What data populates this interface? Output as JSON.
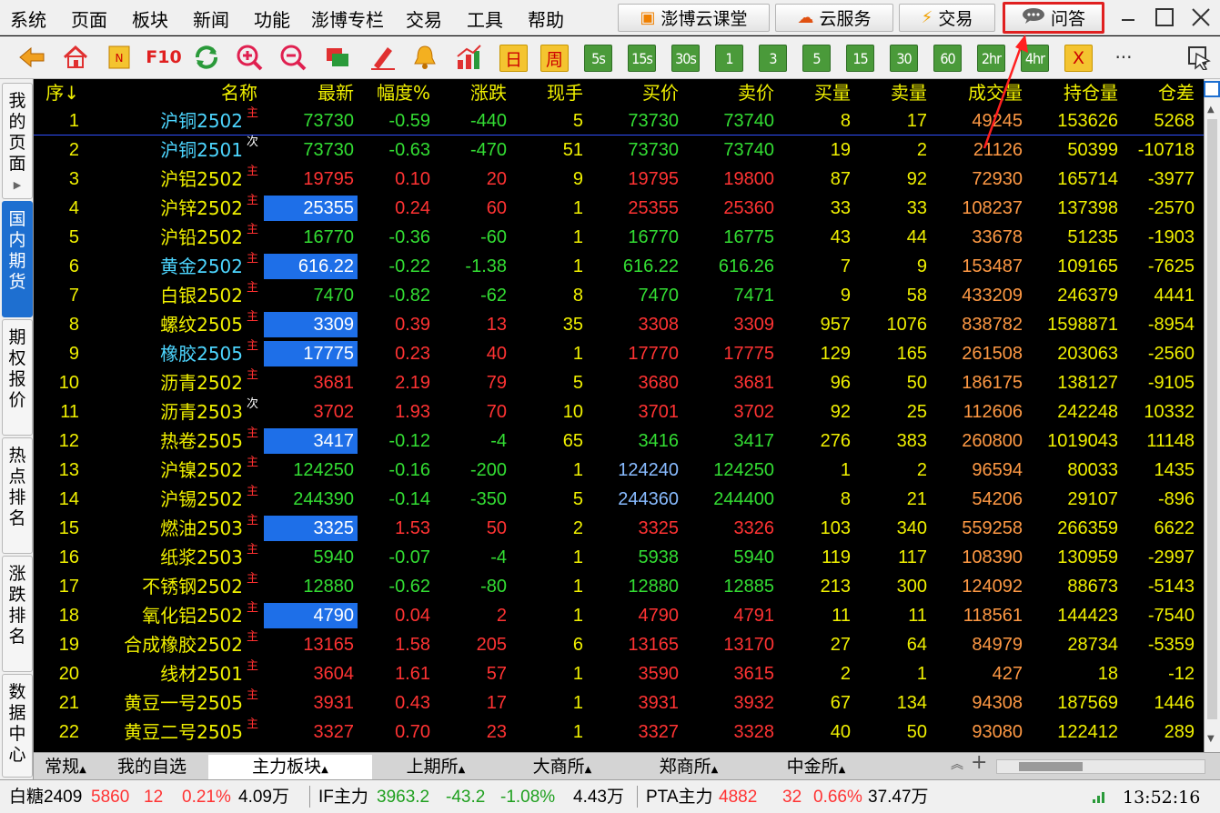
{
  "menu": [
    "系统",
    "页面",
    "板块",
    "新闻",
    "功能",
    "澎博专栏",
    "交易",
    "工具",
    "帮助"
  ],
  "top_buttons": [
    {
      "label": "澎博云课堂",
      "icon": "classroom-icon"
    },
    {
      "label": "云服务",
      "icon": "cloud-icon"
    },
    {
      "label": "交易",
      "icon": "lightning-icon"
    },
    {
      "label": "问答",
      "icon": "chat-bubble-icon"
    }
  ],
  "toolbar": {
    "f10_label": "F10",
    "day_label": "日",
    "week_label": "周",
    "periods": [
      "5s",
      "15s",
      "30s",
      "1",
      "3",
      "5",
      "15",
      "30",
      "60",
      "2hr",
      "4hr"
    ],
    "x_label": "X",
    "more_label": "···"
  },
  "sidebar": [
    {
      "label": [
        "我",
        "的",
        "页",
        "面"
      ],
      "arrow": "▶"
    },
    {
      "label": [
        "国",
        "内",
        "期",
        "货"
      ]
    },
    {
      "label": [
        "期",
        "权",
        "报",
        "价"
      ]
    },
    {
      "label": [
        "热",
        "点",
        "排",
        "名"
      ]
    },
    {
      "label": [
        "涨",
        "跌",
        "排",
        "名"
      ]
    },
    {
      "label": [
        "数",
        "据",
        "中",
        "心"
      ]
    }
  ],
  "columns": [
    "序↓",
    "名称",
    "最新",
    "幅度%",
    "涨跌",
    "现手",
    "买价",
    "卖价",
    "买量",
    "卖量",
    "成交量",
    "持仓量",
    "仓差"
  ],
  "rows": [
    [
      "1",
      "沪铜2502",
      "主",
      "73730",
      "-0.59",
      "-440",
      "5",
      "73730",
      "73740",
      "8",
      "17",
      "49245",
      "153626",
      "5268"
    ],
    [
      "2",
      "沪铜2501",
      "次",
      "73730",
      "-0.63",
      "-470",
      "51",
      "73730",
      "73740",
      "19",
      "2",
      "21126",
      "50399",
      "-10718"
    ],
    [
      "3",
      "沪铝2502",
      "主",
      "19795",
      "0.10",
      "20",
      "9",
      "19795",
      "19800",
      "87",
      "92",
      "72930",
      "165714",
      "-3977"
    ],
    [
      "4",
      "沪锌2502",
      "主",
      "25355",
      "0.24",
      "60",
      "1",
      "25355",
      "25360",
      "33",
      "33",
      "108237",
      "137398",
      "-2570"
    ],
    [
      "5",
      "沪铅2502",
      "主",
      "16770",
      "-0.36",
      "-60",
      "1",
      "16770",
      "16775",
      "43",
      "44",
      "33678",
      "51235",
      "-1903"
    ],
    [
      "6",
      "黄金2502",
      "主",
      "616.22",
      "-0.22",
      "-1.38",
      "1",
      "616.22",
      "616.26",
      "7",
      "9",
      "153487",
      "109165",
      "-7625"
    ],
    [
      "7",
      "白银2502",
      "主",
      "7470",
      "-0.82",
      "-62",
      "8",
      "7470",
      "7471",
      "9",
      "58",
      "433209",
      "246379",
      "4441"
    ],
    [
      "8",
      "螺纹2505",
      "主",
      "3309",
      "0.39",
      "13",
      "35",
      "3308",
      "3309",
      "957",
      "1076",
      "838782",
      "1598871",
      "-8954"
    ],
    [
      "9",
      "橡胶2505",
      "主",
      "17775",
      "0.23",
      "40",
      "1",
      "17770",
      "17775",
      "129",
      "165",
      "261508",
      "203063",
      "-2560"
    ],
    [
      "10",
      "沥青2502",
      "主",
      "3681",
      "2.19",
      "79",
      "5",
      "3680",
      "3681",
      "96",
      "50",
      "186175",
      "138127",
      "-9105"
    ],
    [
      "11",
      "沥青2503",
      "次",
      "3702",
      "1.93",
      "70",
      "10",
      "3701",
      "3702",
      "92",
      "25",
      "112606",
      "242248",
      "10332"
    ],
    [
      "12",
      "热卷2505",
      "主",
      "3417",
      "-0.12",
      "-4",
      "65",
      "3416",
      "3417",
      "276",
      "383",
      "260800",
      "1019043",
      "11148"
    ],
    [
      "13",
      "沪镍2502",
      "主",
      "124250",
      "-0.16",
      "-200",
      "1",
      "124240",
      "124250",
      "1",
      "2",
      "96594",
      "80033",
      "1435"
    ],
    [
      "14",
      "沪锡2502",
      "主",
      "244390",
      "-0.14",
      "-350",
      "5",
      "244360",
      "244400",
      "8",
      "21",
      "54206",
      "29107",
      "-896"
    ],
    [
      "15",
      "燃油2503",
      "主",
      "3325",
      "1.53",
      "50",
      "2",
      "3325",
      "3326",
      "103",
      "340",
      "559258",
      "266359",
      "6622"
    ],
    [
      "16",
      "纸浆2503",
      "主",
      "5940",
      "-0.07",
      "-4",
      "1",
      "5938",
      "5940",
      "119",
      "117",
      "108390",
      "130959",
      "-2997"
    ],
    [
      "17",
      "不锈钢2502",
      "主",
      "12880",
      "-0.62",
      "-80",
      "1",
      "12880",
      "12885",
      "213",
      "300",
      "124092",
      "88673",
      "-5143"
    ],
    [
      "18",
      "氧化铝2502",
      "主",
      "4790",
      "0.04",
      "2",
      "1",
      "4790",
      "4791",
      "11",
      "11",
      "118561",
      "144423",
      "-7540"
    ],
    [
      "19",
      "合成橡胶2502",
      "主",
      "13165",
      "1.58",
      "205",
      "6",
      "13165",
      "13170",
      "27",
      "64",
      "84979",
      "28734",
      "-5359"
    ],
    [
      "20",
      "线材2501",
      "主",
      "3604",
      "1.61",
      "57",
      "1",
      "3590",
      "3615",
      "2",
      "1",
      "427",
      "18",
      "-12"
    ],
    [
      "21",
      "黄豆一号2505",
      "主",
      "3931",
      "0.43",
      "17",
      "1",
      "3931",
      "3932",
      "67",
      "134",
      "94308",
      "187569",
      "1446"
    ],
    [
      "22",
      "黄豆二号2505",
      "主",
      "3327",
      "0.70",
      "23",
      "1",
      "3327",
      "3328",
      "40",
      "50",
      "93080",
      "122412",
      "289"
    ]
  ],
  "highlighted_rows": [
    4,
    6,
    8,
    9,
    12,
    15,
    18
  ],
  "sheet_tabs": [
    "常规",
    "我的自选",
    "主力板块",
    "上期所",
    "大商所",
    "郑商所",
    "中金所"
  ],
  "status": [
    {
      "name": "白糖2409",
      "price": "5860",
      "change": "12",
      "pct": "0.21%",
      "vol": "4.09万"
    },
    {
      "name": "IF主力",
      "price": "3963.2",
      "change": "-43.2",
      "pct": "-1.08%",
      "vol": "4.43万"
    },
    {
      "name": "PTA主力",
      "price": "4882",
      "change": "32",
      "pct": "0.66%",
      "vol": "37.47万"
    }
  ],
  "clock": "13:52:16",
  "colors": {
    "up": "#ff3333",
    "down": "#33dd33",
    "name": "#f0f000",
    "vol": "#ff9944",
    "hold": "#f0f000",
    "neutral": "#ffffff",
    "bid_special": "#88bbff"
  }
}
